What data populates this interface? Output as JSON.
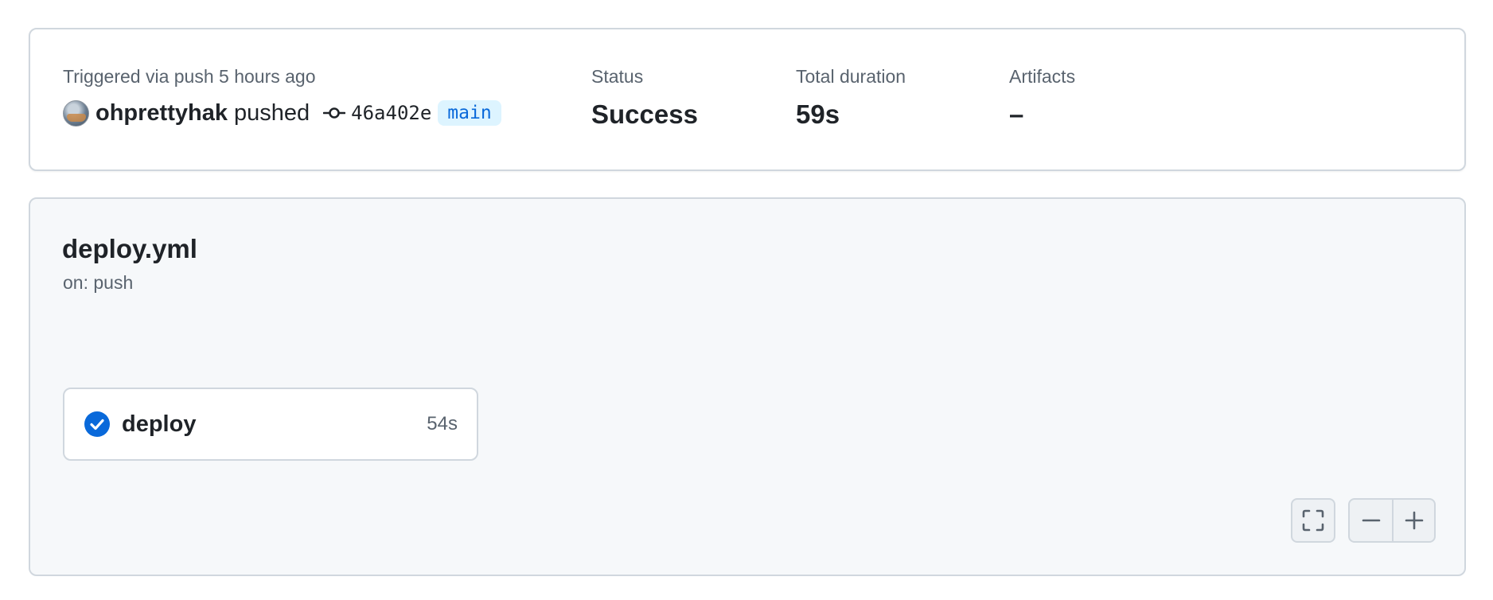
{
  "summary": {
    "trigger_label": "Triggered via push 5 hours ago",
    "actor": "ohprettyhak",
    "action": "pushed",
    "commit_sha": "46a402e",
    "branch": "main",
    "status_label": "Status",
    "status_value": "Success",
    "duration_label": "Total duration",
    "duration_value": "59s",
    "artifacts_label": "Artifacts",
    "artifacts_value": "–"
  },
  "workflow": {
    "file": "deploy.yml",
    "trigger": "on: push",
    "jobs": [
      {
        "name": "deploy",
        "duration": "54s",
        "status": "success",
        "icon": "check-circle-icon"
      }
    ]
  },
  "controls": {
    "fullscreen_icon": "fullscreen-icon",
    "zoom_out_icon": "zoom-out-icon",
    "zoom_in_icon": "zoom-in-icon"
  },
  "colors": {
    "success": "#0969da",
    "branch_bg": "#ddf4ff",
    "panel_bg": "#f6f8fa",
    "border": "#d0d7de"
  }
}
